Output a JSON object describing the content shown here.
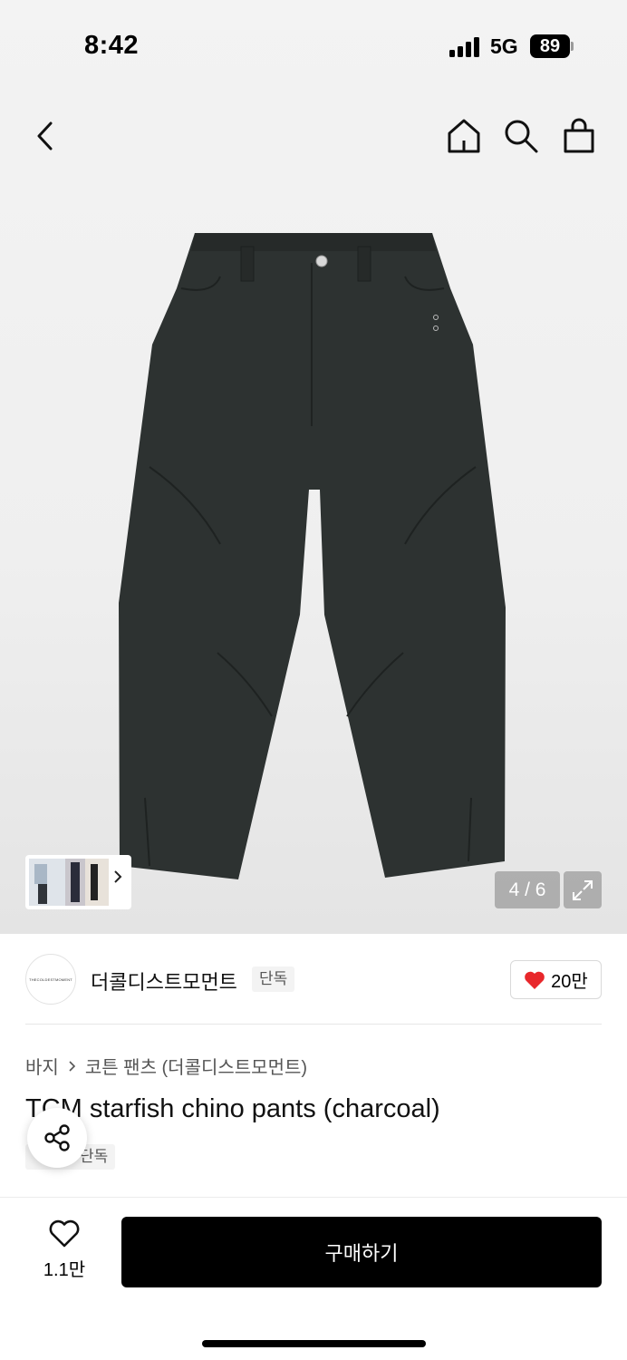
{
  "status_bar": {
    "time": "8:42",
    "network": "5G",
    "battery": "89"
  },
  "nav": {
    "icons": [
      "back-icon",
      "home-icon",
      "search-icon",
      "shopping-bag-icon"
    ]
  },
  "gallery": {
    "counter": "4 / 6",
    "current": 4,
    "total": 6
  },
  "brand": {
    "name": "더콜디스트모먼트",
    "tag": "단독",
    "logo_text": "THECOLDESTMOMENT",
    "likes": "20만",
    "like_color": "#e8272b"
  },
  "product": {
    "breadcrumb": [
      "바지",
      "코튼 팬츠 (더콜디스트모먼트)"
    ],
    "title": "TCM starfish chino pants (charcoal)",
    "tag": "단독"
  },
  "bottom_bar": {
    "wish_count": "1.1만",
    "buy_label": "구매하기"
  },
  "colors": {
    "pants": "#2d3231",
    "buy_button": "#000000",
    "heart": "#e8272b"
  }
}
